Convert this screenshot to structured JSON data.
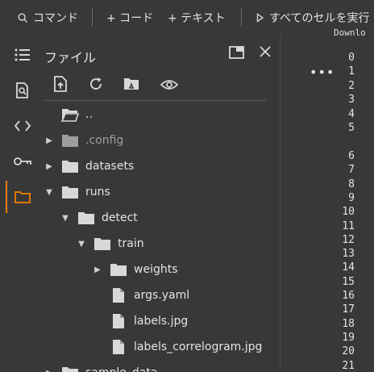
{
  "toolbar": {
    "command_label": "コマンド",
    "code_label": "+ コード",
    "text_label": "+ テキスト",
    "run_all_label": "すべてのセルを実行"
  },
  "rail": {
    "items": [
      {
        "name": "toc-icon"
      },
      {
        "name": "find-icon"
      },
      {
        "name": "code-snippets-icon"
      },
      {
        "name": "secrets-key-icon"
      },
      {
        "name": "files-folder-icon",
        "active": true
      }
    ],
    "active_color": "#f57c00"
  },
  "files_panel": {
    "title": "ファイル",
    "tools": [
      "upload-icon",
      "refresh-icon",
      "drive-icon",
      "eye-icon"
    ],
    "tree": [
      {
        "label": "..",
        "type": "parent-folder",
        "depth": 0,
        "expanded": null
      },
      {
        "label": ".config",
        "type": "folder",
        "depth": 0,
        "expanded": false,
        "dim": true
      },
      {
        "label": "datasets",
        "type": "folder",
        "depth": 0,
        "expanded": false
      },
      {
        "label": "runs",
        "type": "folder",
        "depth": 0,
        "expanded": true
      },
      {
        "label": "detect",
        "type": "folder",
        "depth": 1,
        "expanded": true
      },
      {
        "label": "train",
        "type": "folder",
        "depth": 2,
        "expanded": true
      },
      {
        "label": "weights",
        "type": "folder",
        "depth": 3,
        "expanded": false
      },
      {
        "label": "args.yaml",
        "type": "file",
        "depth": 3
      },
      {
        "label": "labels.jpg",
        "type": "file",
        "depth": 3
      },
      {
        "label": "labels_correlogram.jpg",
        "type": "file",
        "depth": 3
      },
      {
        "label": "sample_data",
        "type": "folder",
        "depth": 0,
        "expanded": false
      }
    ]
  },
  "output": {
    "header_text": "Downlo",
    "more_label": "•••",
    "line_numbers": [
      "0",
      "1",
      "2",
      "3",
      "4",
      "5",
      "6",
      "7",
      "8",
      "9",
      "10",
      "11",
      "12",
      "13",
      "14",
      "15",
      "16",
      "17",
      "18",
      "19",
      "20",
      "21"
    ]
  }
}
